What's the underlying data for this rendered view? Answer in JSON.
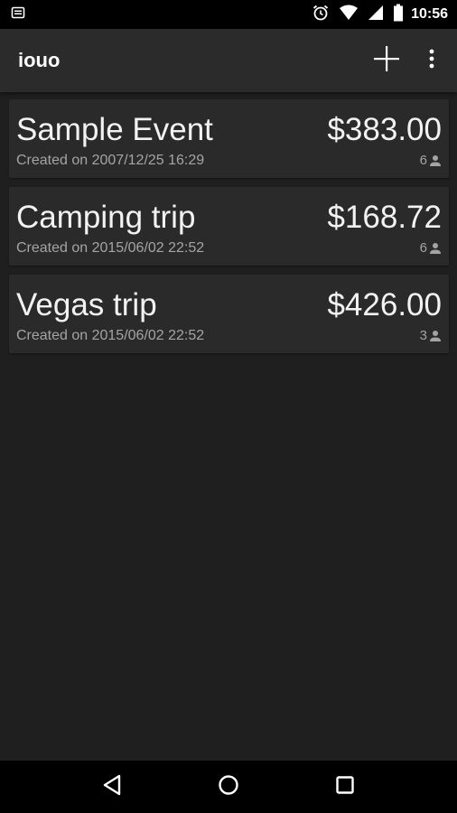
{
  "status_bar": {
    "time": "10:56",
    "icons": [
      "notification-icon",
      "alarm-icon",
      "wifi-icon",
      "cell-signal-icon",
      "battery-icon"
    ]
  },
  "app_bar": {
    "title": "iouo",
    "actions": [
      "add-icon",
      "more-vert-icon"
    ]
  },
  "events": [
    {
      "name": "Sample Event",
      "created": "Created on 2007/12/25 16:29",
      "total": "$383.00",
      "people": "6"
    },
    {
      "name": "Camping trip",
      "created": "Created on 2015/06/02 22:52",
      "total": "$168.72",
      "people": "6"
    },
    {
      "name": "Vegas trip",
      "created": "Created on 2015/06/02 22:52",
      "total": "$426.00",
      "people": "3"
    }
  ],
  "nav_bar": {
    "buttons": [
      "back-icon",
      "home-icon",
      "recents-icon"
    ]
  },
  "colors": {
    "background": "#1f1f1f",
    "app_bar": "#2b2b2b",
    "card": "#2a2a2a",
    "text_primary": "#f2f2f2",
    "text_secondary": "#a4a4a4"
  }
}
